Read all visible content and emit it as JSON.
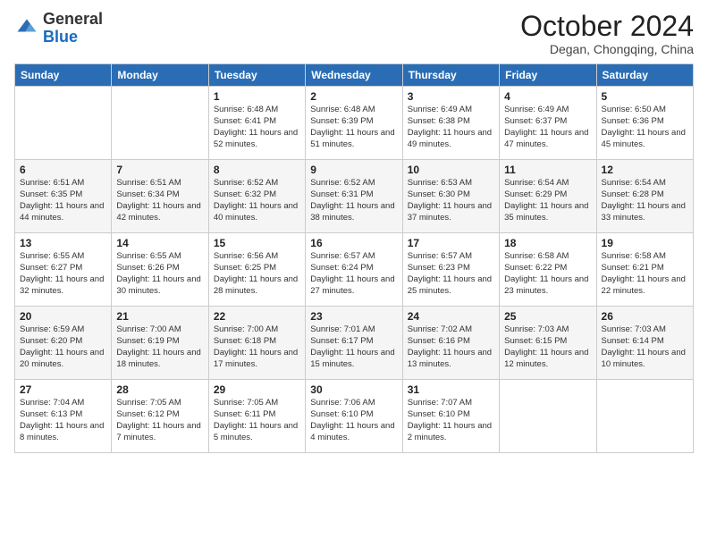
{
  "header": {
    "logo_general": "General",
    "logo_blue": "Blue",
    "month_title": "October 2024",
    "location": "Degan, Chongqing, China"
  },
  "weekdays": [
    "Sunday",
    "Monday",
    "Tuesday",
    "Wednesday",
    "Thursday",
    "Friday",
    "Saturday"
  ],
  "weeks": [
    [
      {
        "day": "",
        "info": ""
      },
      {
        "day": "",
        "info": ""
      },
      {
        "day": "1",
        "info": "Sunrise: 6:48 AM\nSunset: 6:41 PM\nDaylight: 11 hours and 52 minutes."
      },
      {
        "day": "2",
        "info": "Sunrise: 6:48 AM\nSunset: 6:39 PM\nDaylight: 11 hours and 51 minutes."
      },
      {
        "day": "3",
        "info": "Sunrise: 6:49 AM\nSunset: 6:38 PM\nDaylight: 11 hours and 49 minutes."
      },
      {
        "day": "4",
        "info": "Sunrise: 6:49 AM\nSunset: 6:37 PM\nDaylight: 11 hours and 47 minutes."
      },
      {
        "day": "5",
        "info": "Sunrise: 6:50 AM\nSunset: 6:36 PM\nDaylight: 11 hours and 45 minutes."
      }
    ],
    [
      {
        "day": "6",
        "info": "Sunrise: 6:51 AM\nSunset: 6:35 PM\nDaylight: 11 hours and 44 minutes."
      },
      {
        "day": "7",
        "info": "Sunrise: 6:51 AM\nSunset: 6:34 PM\nDaylight: 11 hours and 42 minutes."
      },
      {
        "day": "8",
        "info": "Sunrise: 6:52 AM\nSunset: 6:32 PM\nDaylight: 11 hours and 40 minutes."
      },
      {
        "day": "9",
        "info": "Sunrise: 6:52 AM\nSunset: 6:31 PM\nDaylight: 11 hours and 38 minutes."
      },
      {
        "day": "10",
        "info": "Sunrise: 6:53 AM\nSunset: 6:30 PM\nDaylight: 11 hours and 37 minutes."
      },
      {
        "day": "11",
        "info": "Sunrise: 6:54 AM\nSunset: 6:29 PM\nDaylight: 11 hours and 35 minutes."
      },
      {
        "day": "12",
        "info": "Sunrise: 6:54 AM\nSunset: 6:28 PM\nDaylight: 11 hours and 33 minutes."
      }
    ],
    [
      {
        "day": "13",
        "info": "Sunrise: 6:55 AM\nSunset: 6:27 PM\nDaylight: 11 hours and 32 minutes."
      },
      {
        "day": "14",
        "info": "Sunrise: 6:55 AM\nSunset: 6:26 PM\nDaylight: 11 hours and 30 minutes."
      },
      {
        "day": "15",
        "info": "Sunrise: 6:56 AM\nSunset: 6:25 PM\nDaylight: 11 hours and 28 minutes."
      },
      {
        "day": "16",
        "info": "Sunrise: 6:57 AM\nSunset: 6:24 PM\nDaylight: 11 hours and 27 minutes."
      },
      {
        "day": "17",
        "info": "Sunrise: 6:57 AM\nSunset: 6:23 PM\nDaylight: 11 hours and 25 minutes."
      },
      {
        "day": "18",
        "info": "Sunrise: 6:58 AM\nSunset: 6:22 PM\nDaylight: 11 hours and 23 minutes."
      },
      {
        "day": "19",
        "info": "Sunrise: 6:58 AM\nSunset: 6:21 PM\nDaylight: 11 hours and 22 minutes."
      }
    ],
    [
      {
        "day": "20",
        "info": "Sunrise: 6:59 AM\nSunset: 6:20 PM\nDaylight: 11 hours and 20 minutes."
      },
      {
        "day": "21",
        "info": "Sunrise: 7:00 AM\nSunset: 6:19 PM\nDaylight: 11 hours and 18 minutes."
      },
      {
        "day": "22",
        "info": "Sunrise: 7:00 AM\nSunset: 6:18 PM\nDaylight: 11 hours and 17 minutes."
      },
      {
        "day": "23",
        "info": "Sunrise: 7:01 AM\nSunset: 6:17 PM\nDaylight: 11 hours and 15 minutes."
      },
      {
        "day": "24",
        "info": "Sunrise: 7:02 AM\nSunset: 6:16 PM\nDaylight: 11 hours and 13 minutes."
      },
      {
        "day": "25",
        "info": "Sunrise: 7:03 AM\nSunset: 6:15 PM\nDaylight: 11 hours and 12 minutes."
      },
      {
        "day": "26",
        "info": "Sunrise: 7:03 AM\nSunset: 6:14 PM\nDaylight: 11 hours and 10 minutes."
      }
    ],
    [
      {
        "day": "27",
        "info": "Sunrise: 7:04 AM\nSunset: 6:13 PM\nDaylight: 11 hours and 8 minutes."
      },
      {
        "day": "28",
        "info": "Sunrise: 7:05 AM\nSunset: 6:12 PM\nDaylight: 11 hours and 7 minutes."
      },
      {
        "day": "29",
        "info": "Sunrise: 7:05 AM\nSunset: 6:11 PM\nDaylight: 11 hours and 5 minutes."
      },
      {
        "day": "30",
        "info": "Sunrise: 7:06 AM\nSunset: 6:10 PM\nDaylight: 11 hours and 4 minutes."
      },
      {
        "day": "31",
        "info": "Sunrise: 7:07 AM\nSunset: 6:10 PM\nDaylight: 11 hours and 2 minutes."
      },
      {
        "day": "",
        "info": ""
      },
      {
        "day": "",
        "info": ""
      }
    ]
  ]
}
